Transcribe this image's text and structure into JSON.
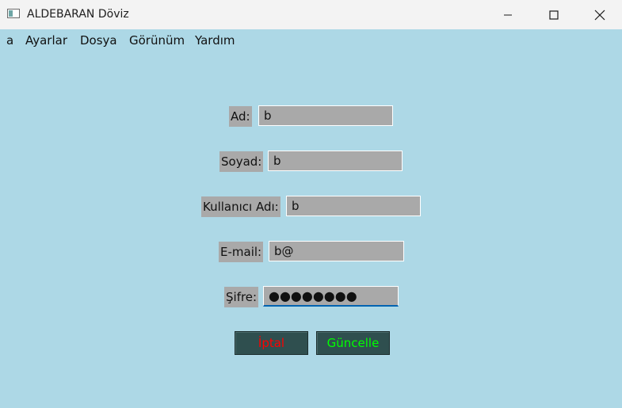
{
  "window": {
    "title": "ALDEBARAN Döviz",
    "minimize_icon": "minimize-icon",
    "maximize_icon": "maximize-icon",
    "close_icon": "close-icon"
  },
  "menu": {
    "items": [
      "a",
      "Ayarlar",
      "Dosya",
      "Görünüm",
      "Yardım"
    ]
  },
  "form": {
    "ad": {
      "label": "Ad:",
      "value": "b"
    },
    "soyad": {
      "label": "Soyad:",
      "value": "b"
    },
    "kullanici_adi": {
      "label": "Kullanıcı Adı:",
      "value": "b"
    },
    "email": {
      "label": "E-mail:",
      "value": "b@"
    },
    "sifre": {
      "label": "Şifre:",
      "value": "●●●●●●●●"
    }
  },
  "buttons": {
    "cancel": {
      "label": "İptal",
      "color": "#ff0000"
    },
    "update": {
      "label": "Güncelle",
      "color": "#00ff00"
    }
  },
  "colors": {
    "background": "#add8e6",
    "field": "#a9a9a9",
    "button": "#2f4f4f"
  }
}
